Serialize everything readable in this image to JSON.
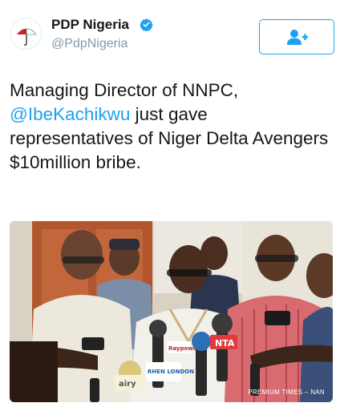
{
  "tweet": {
    "display_name": "PDP Nigeria",
    "handle": "@PdpNigeria",
    "text_part1": "Managing Director of NNPC, ",
    "mention": "@IbeKachikwu",
    "text_part2": " just gave representatives of Niger Delta Avengers $10million bribe.",
    "verified_icon": "verified-badge-icon",
    "follow_icon": "add-user-icon"
  },
  "photo": {
    "credit": "PREMIUM TIMES – NAN",
    "mic_labels": [
      "Raypower",
      "NTA",
      "RHEN LONDON",
      "airy"
    ]
  },
  "colors": {
    "accent": "#1da1f2",
    "text": "#14171a",
    "muted": "#8899a6"
  }
}
